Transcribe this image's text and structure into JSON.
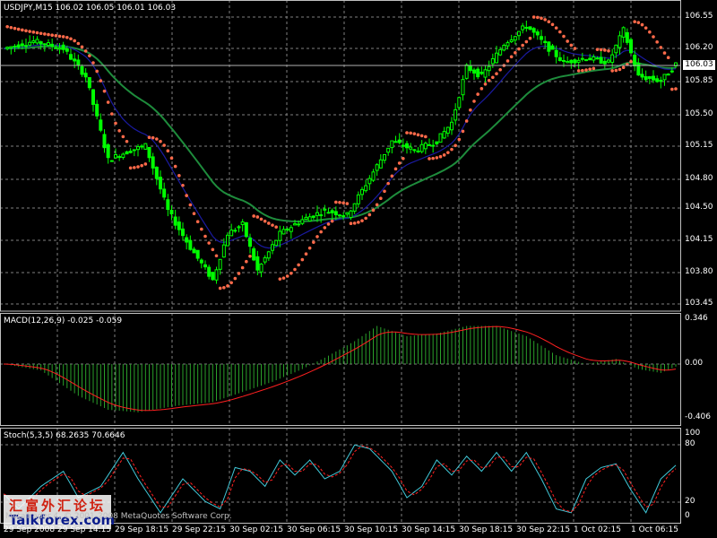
{
  "main_chart": {
    "title": "USDJPY,M15  106.02 106.05 106.01 106.03",
    "current_price": "106.03",
    "price_levels": [
      "106.55",
      "106.20",
      "105.85",
      "105.50",
      "105.15",
      "104.80",
      "104.50",
      "104.15",
      "103.80",
      "103.45"
    ]
  },
  "macd_panel": {
    "title": "MACD(12,26,9) -0.025 -0.059",
    "levels": [
      "0.346",
      "0.00",
      "-0.406"
    ]
  },
  "stoch_panel": {
    "title": "Stoch(5,3,5) 68.2635 70.6646",
    "levels": [
      "100",
      "80",
      "20",
      "0"
    ]
  },
  "time_axis": [
    "29 Sep 2008",
    "29 Sep 14:15",
    "29 Sep 18:15",
    "29 Sep 22:15",
    "30 Sep 02:15",
    "30 Sep 06:15",
    "30 Sep 10:15",
    "30 Sep 14:15",
    "30 Sep 18:15",
    "30 Sep 22:15",
    "1 Oct 02:15",
    "1 Oct 06:15"
  ],
  "watermark": {
    "cn": "汇富外汇论坛",
    "url": "Talkforex.com"
  },
  "copyright": "MetaTrader 4, © 2001-2008 MetaQuotes Software Corp.",
  "colors": {
    "background": "#000000",
    "grid": "#808080",
    "bull_candle": "#00ff00",
    "bear_candle": "#00ff00",
    "ma_slow": "#1e8c3c",
    "ma_fast": "#1a1aa0",
    "sar": "#ff6a4a",
    "macd_hist": "#2aa02a",
    "macd_signal": "#ff2020",
    "stoch_main": "#40c8d8",
    "stoch_signal": "#ff2020"
  },
  "chart_data": {
    "type": "line",
    "symbol": "USDJPY",
    "timeframe": "M15",
    "ylim": [
      103.45,
      106.55
    ],
    "close_keypoints": [
      {
        "t": 0,
        "v": 106.2
      },
      {
        "t": 8,
        "v": 106.28
      },
      {
        "t": 16,
        "v": 106.2
      },
      {
        "t": 22,
        "v": 105.9
      },
      {
        "t": 28,
        "v": 105.0
      },
      {
        "t": 34,
        "v": 105.1
      },
      {
        "t": 38,
        "v": 105.15
      },
      {
        "t": 44,
        "v": 104.45
      },
      {
        "t": 50,
        "v": 104.05
      },
      {
        "t": 56,
        "v": 103.7
      },
      {
        "t": 60,
        "v": 104.2
      },
      {
        "t": 64,
        "v": 104.3
      },
      {
        "t": 68,
        "v": 103.8
      },
      {
        "t": 74,
        "v": 104.2
      },
      {
        "t": 80,
        "v": 104.35
      },
      {
        "t": 86,
        "v": 104.45
      },
      {
        "t": 92,
        "v": 104.4
      },
      {
        "t": 98,
        "v": 104.8
      },
      {
        "t": 104,
        "v": 105.2
      },
      {
        "t": 110,
        "v": 105.1
      },
      {
        "t": 116,
        "v": 105.2
      },
      {
        "t": 120,
        "v": 105.4
      },
      {
        "t": 124,
        "v": 106.0
      },
      {
        "t": 128,
        "v": 105.9
      },
      {
        "t": 134,
        "v": 106.25
      },
      {
        "t": 140,
        "v": 106.45
      },
      {
        "t": 146,
        "v": 106.2
      },
      {
        "t": 150,
        "v": 106.05
      },
      {
        "t": 156,
        "v": 106.1
      },
      {
        "t": 162,
        "v": 106.05
      },
      {
        "t": 166,
        "v": 106.4
      },
      {
        "t": 170,
        "v": 105.9
      },
      {
        "t": 176,
        "v": 105.85
      },
      {
        "t": 180,
        "v": 106.03
      }
    ],
    "macd_keypoints": [
      {
        "t": 0,
        "v": 0.0
      },
      {
        "t": 10,
        "v": -0.05
      },
      {
        "t": 20,
        "v": -0.25
      },
      {
        "t": 28,
        "v": -0.36
      },
      {
        "t": 36,
        "v": -0.38
      },
      {
        "t": 46,
        "v": -0.33
      },
      {
        "t": 56,
        "v": -0.3
      },
      {
        "t": 64,
        "v": -0.22
      },
      {
        "t": 72,
        "v": -0.14
      },
      {
        "t": 80,
        "v": -0.04
      },
      {
        "t": 86,
        "v": 0.05
      },
      {
        "t": 94,
        "v": 0.18
      },
      {
        "t": 100,
        "v": 0.3
      },
      {
        "t": 108,
        "v": 0.22
      },
      {
        "t": 116,
        "v": 0.24
      },
      {
        "t": 124,
        "v": 0.3
      },
      {
        "t": 132,
        "v": 0.3
      },
      {
        "t": 140,
        "v": 0.22
      },
      {
        "t": 148,
        "v": 0.07
      },
      {
        "t": 156,
        "v": 0.0
      },
      {
        "t": 164,
        "v": 0.04
      },
      {
        "t": 170,
        "v": -0.04
      },
      {
        "t": 176,
        "v": -0.07
      },
      {
        "t": 180,
        "v": -0.02
      }
    ],
    "stoch_keypoints": [
      {
        "t": 0,
        "v": 30
      },
      {
        "t": 4,
        "v": 10
      },
      {
        "t": 10,
        "v": 40
      },
      {
        "t": 16,
        "v": 60
      },
      {
        "t": 20,
        "v": 25
      },
      {
        "t": 26,
        "v": 40
      },
      {
        "t": 32,
        "v": 85
      },
      {
        "t": 36,
        "v": 50
      },
      {
        "t": 42,
        "v": 5
      },
      {
        "t": 48,
        "v": 50
      },
      {
        "t": 54,
        "v": 20
      },
      {
        "t": 58,
        "v": 10
      },
      {
        "t": 62,
        "v": 65
      },
      {
        "t": 66,
        "v": 60
      },
      {
        "t": 70,
        "v": 40
      },
      {
        "t": 74,
        "v": 75
      },
      {
        "t": 78,
        "v": 55
      },
      {
        "t": 82,
        "v": 75
      },
      {
        "t": 86,
        "v": 50
      },
      {
        "t": 90,
        "v": 60
      },
      {
        "t": 94,
        "v": 95
      },
      {
        "t": 98,
        "v": 90
      },
      {
        "t": 104,
        "v": 60
      },
      {
        "t": 108,
        "v": 25
      },
      {
        "t": 112,
        "v": 40
      },
      {
        "t": 116,
        "v": 75
      },
      {
        "t": 120,
        "v": 55
      },
      {
        "t": 124,
        "v": 80
      },
      {
        "t": 128,
        "v": 60
      },
      {
        "t": 132,
        "v": 85
      },
      {
        "t": 136,
        "v": 60
      },
      {
        "t": 140,
        "v": 85
      },
      {
        "t": 144,
        "v": 50
      },
      {
        "t": 148,
        "v": 10
      },
      {
        "t": 152,
        "v": 5
      },
      {
        "t": 156,
        "v": 50
      },
      {
        "t": 160,
        "v": 65
      },
      {
        "t": 164,
        "v": 70
      },
      {
        "t": 168,
        "v": 35
      },
      {
        "t": 172,
        "v": 5
      },
      {
        "t": 176,
        "v": 50
      },
      {
        "t": 180,
        "v": 68
      }
    ]
  }
}
